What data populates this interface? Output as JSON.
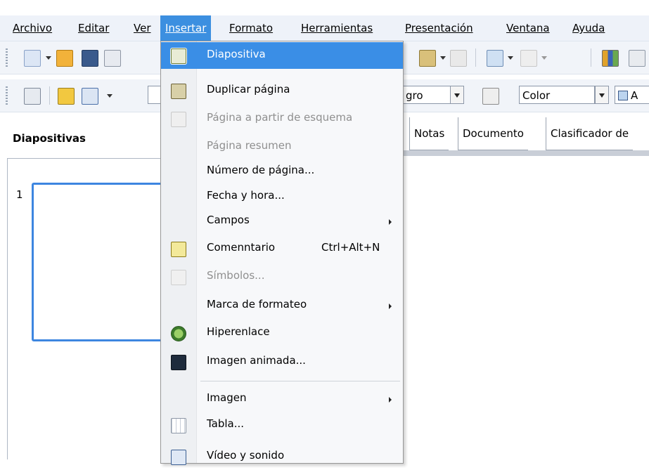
{
  "menubar": {
    "items": [
      "Archivo",
      "Editar",
      "Ver",
      "Insertar",
      "Formato",
      "Herramientas",
      "Presentación",
      "Ventana",
      "Ayuda"
    ],
    "active": "Insertar"
  },
  "toolbar2": {
    "combo_partial": "gro",
    "combo_color": "Color",
    "right_partial": "A"
  },
  "slides_pane": {
    "title": "Diapositivas",
    "slide_number": "1"
  },
  "tabs": [
    "Notas",
    "Documento",
    "Clasificador de"
  ],
  "insert_menu": {
    "items": [
      {
        "label": "Diapositiva",
        "state": "selected",
        "icon": "slide-icon"
      },
      {
        "label": "Duplicar página",
        "state": "enabled",
        "icon": "duplicate-page-icon"
      },
      {
        "label": "Página a partir de esquema",
        "state": "disabled",
        "icon": "outline-page-icon"
      },
      {
        "label": "Página resumen",
        "state": "disabled"
      },
      {
        "label": "Número de página...",
        "state": "enabled"
      },
      {
        "label": "Fecha y hora...",
        "state": "enabled"
      },
      {
        "label": "Campos",
        "state": "submenu"
      },
      {
        "label": "Comenntario",
        "shortcut": "Ctrl+Alt+N",
        "state": "enabled",
        "icon": "comment-icon"
      },
      {
        "label": "Símbolos...",
        "state": "disabled",
        "icon": "symbols-icon"
      },
      {
        "label": "Marca de formateo",
        "state": "submenu"
      },
      {
        "label": "Hiperenlace",
        "state": "enabled",
        "icon": "hyperlink-icon"
      },
      {
        "label": "Imagen animada...",
        "state": "enabled",
        "icon": "animated-image-icon"
      },
      {
        "label": "Imagen",
        "state": "submenu"
      },
      {
        "label": "Tabla...",
        "state": "enabled",
        "icon": "table-icon"
      },
      {
        "label": "Vídeo y sonido",
        "state": "enabled",
        "icon": "media-icon"
      }
    ]
  }
}
